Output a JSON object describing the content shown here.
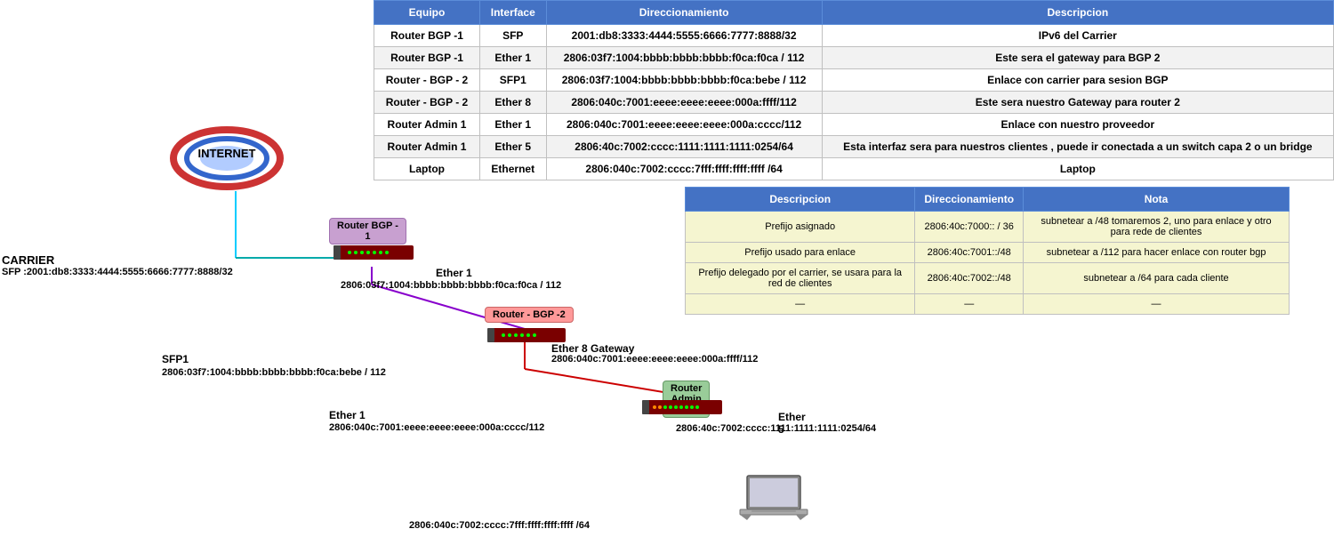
{
  "table": {
    "headers": [
      "Equipo",
      "Interface",
      "Direccionamiento",
      "Descripcion"
    ],
    "rows": [
      {
        "equipo": "Router BGP -1",
        "interface": "SFP",
        "direccionamiento": "2001:db8:3333:4444:5555:6666:7777:8888/32",
        "descripcion": "IPv6 del Carrier"
      },
      {
        "equipo": "Router BGP -1",
        "interface": "Ether 1",
        "direccionamiento": "2806:03f7:1004:bbbb:bbbb:bbbb:f0ca:f0ca / 112",
        "descripcion": "Este sera el gateway para BGP 2"
      },
      {
        "equipo": "Router - BGP - 2",
        "interface": "SFP1",
        "direccionamiento": "2806:03f7:1004:bbbb:bbbb:bbbb:f0ca:bebe / 112",
        "descripcion": "Enlace con carrier para sesion BGP"
      },
      {
        "equipo": "Router - BGP - 2",
        "interface": "Ether 8",
        "direccionamiento": "2806:040c:7001:eeee:eeee:eeee:000a:ffff/112",
        "descripcion": "Este sera nuestro Gateway para router 2"
      },
      {
        "equipo": "Router Admin 1",
        "interface": "Ether 1",
        "direccionamiento": "2806:040c:7001:eeee:eeee:eeee:000a:cccc/112",
        "descripcion": "Enlace con nuestro proveedor"
      },
      {
        "equipo": "Router Admin 1",
        "interface": "Ether 5",
        "direccionamiento": "2806:40c:7002:cccc:1111:1111:1111:0254/64",
        "descripcion": "Esta interfaz sera para nuestros clientes , puede ir conectada a un switch capa 2 o un bridge"
      },
      {
        "equipo": "Laptop",
        "interface": "Ethernet",
        "direccionamiento": "2806:040c:7002:cccc:7fff:ffff:ffff:ffff /64",
        "descripcion": "Laptop"
      }
    ]
  },
  "second_table": {
    "headers": [
      "Descripcion",
      "Direccionamiento",
      "Nota"
    ],
    "rows": [
      {
        "descripcion": "Prefijo asignado",
        "direccionamiento": "2806:40c:7000:: / 36",
        "nota": "subnetear a /48  tomaremos 2, uno para enlace y otro para rede de clientes"
      },
      {
        "descripcion": "Prefijo usado para enlace",
        "direccionamiento": "2806:40c:7001::/48",
        "nota": "subnetear a /112 para hacer enlace con router bgp"
      },
      {
        "descripcion": "Prefijo delegado por el carrier, se usara para la red de clientes",
        "direccionamiento": "2806:40c:7002::/48",
        "nota": "subnetear a /64 para cada cliente"
      },
      {
        "descripcion": "—",
        "direccionamiento": "—",
        "nota": "—"
      }
    ]
  },
  "diagram": {
    "internet_label": "INTERNET",
    "carrier_label": "CARRIER",
    "carrier_sfp_label": "SFP :2001:db8:3333:4444:5555:6666:7777:8888/32",
    "router_bgp1_label": "Router BGP -\n1",
    "router_bgp2_label": "Router - BGP -2",
    "router_admin1_label": "Router Admin 1",
    "ether1_bgp1_label": "Ether 1",
    "ether1_bgp1_addr": "2806:03f7:1004:bbbb:bbbb:bbbb:f0ca:f0ca / 112",
    "sfp1_bgp2_label": "SFP1",
    "sfp1_bgp2_addr": "2806:03f7:1004:bbbb:bbbb:bbbb:f0ca:bebe / 112",
    "ether8_label": "Ether 8 Gateway",
    "ether8_addr": "2806:040c:7001:eeee:eeee:eeee:000a:ffff/112",
    "ether1_admin_label": "Ether 1",
    "ether1_admin_addr": "2806:040c:7001:eeee:eeee:eeee:000a:cccc/112",
    "ether5_label": "Ether 5",
    "ether5_addr": "2806:40c:7002:cccc:1111:1111:1111:0254/64",
    "laptop_addr": "2806:040c:7002:cccc:7fff:ffff:ffff:ffff /64"
  }
}
